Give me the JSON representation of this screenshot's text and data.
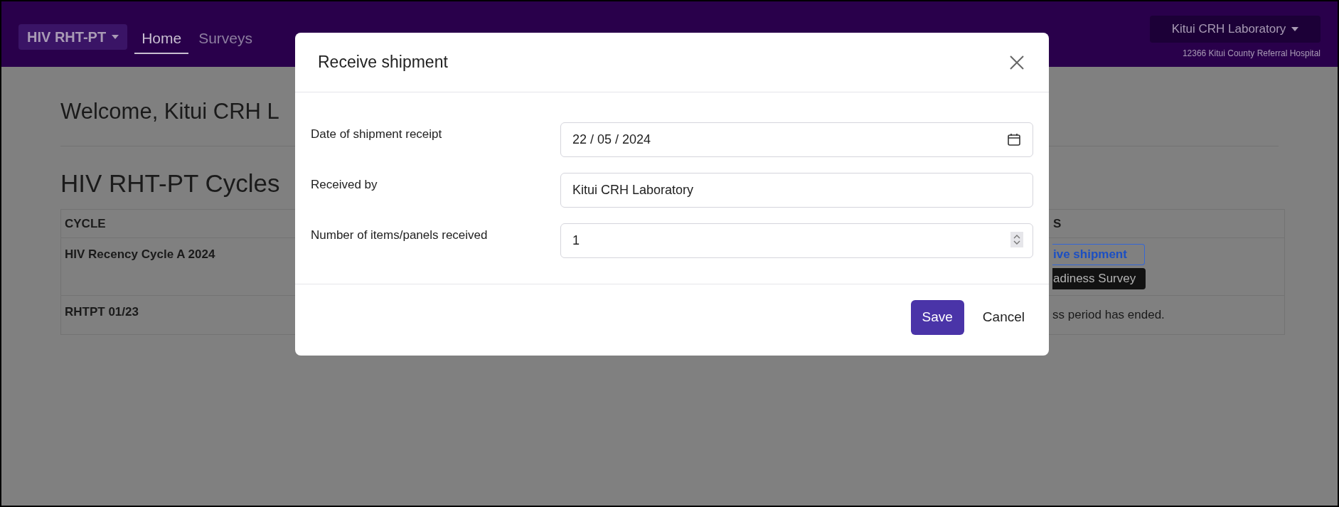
{
  "navbar": {
    "brand": "HIV RHT-PT",
    "links": [
      {
        "label": "Home",
        "selected": true
      },
      {
        "label": "Surveys",
        "selected": false
      }
    ],
    "account": {
      "label": "Kitui CRH Laboratory",
      "subtitle": "12366 Kitui County Referral Hospital"
    }
  },
  "page": {
    "welcome": "Welcome, Kitui CRH L",
    "heading": "HIV RHT-PT Cycles",
    "table": {
      "columns": [
        "CYCLE",
        "S"
      ],
      "rows": [
        {
          "cycle": "HIV Recency Cycle A 2024",
          "actions": [
            {
              "kind": "outline",
              "label": "ive shipment"
            },
            {
              "kind": "dark",
              "label": "adiness Survey"
            }
          ]
        },
        {
          "cycle": "RHTPT 01/23",
          "note": "ss period has ended."
        }
      ]
    }
  },
  "modal": {
    "title": "Receive shipment",
    "fields": [
      {
        "kind": "date",
        "label": "Date of shipment receipt",
        "value": "22 / 05 / 2024"
      },
      {
        "kind": "text",
        "label": "Received by",
        "value": "Kitui CRH Laboratory"
      },
      {
        "kind": "number",
        "label": "Number of items/panels received",
        "value": "1"
      }
    ],
    "buttons": [
      {
        "kind": "primary",
        "label": "Save"
      },
      {
        "kind": "secondary",
        "label": "Cancel"
      }
    ]
  }
}
